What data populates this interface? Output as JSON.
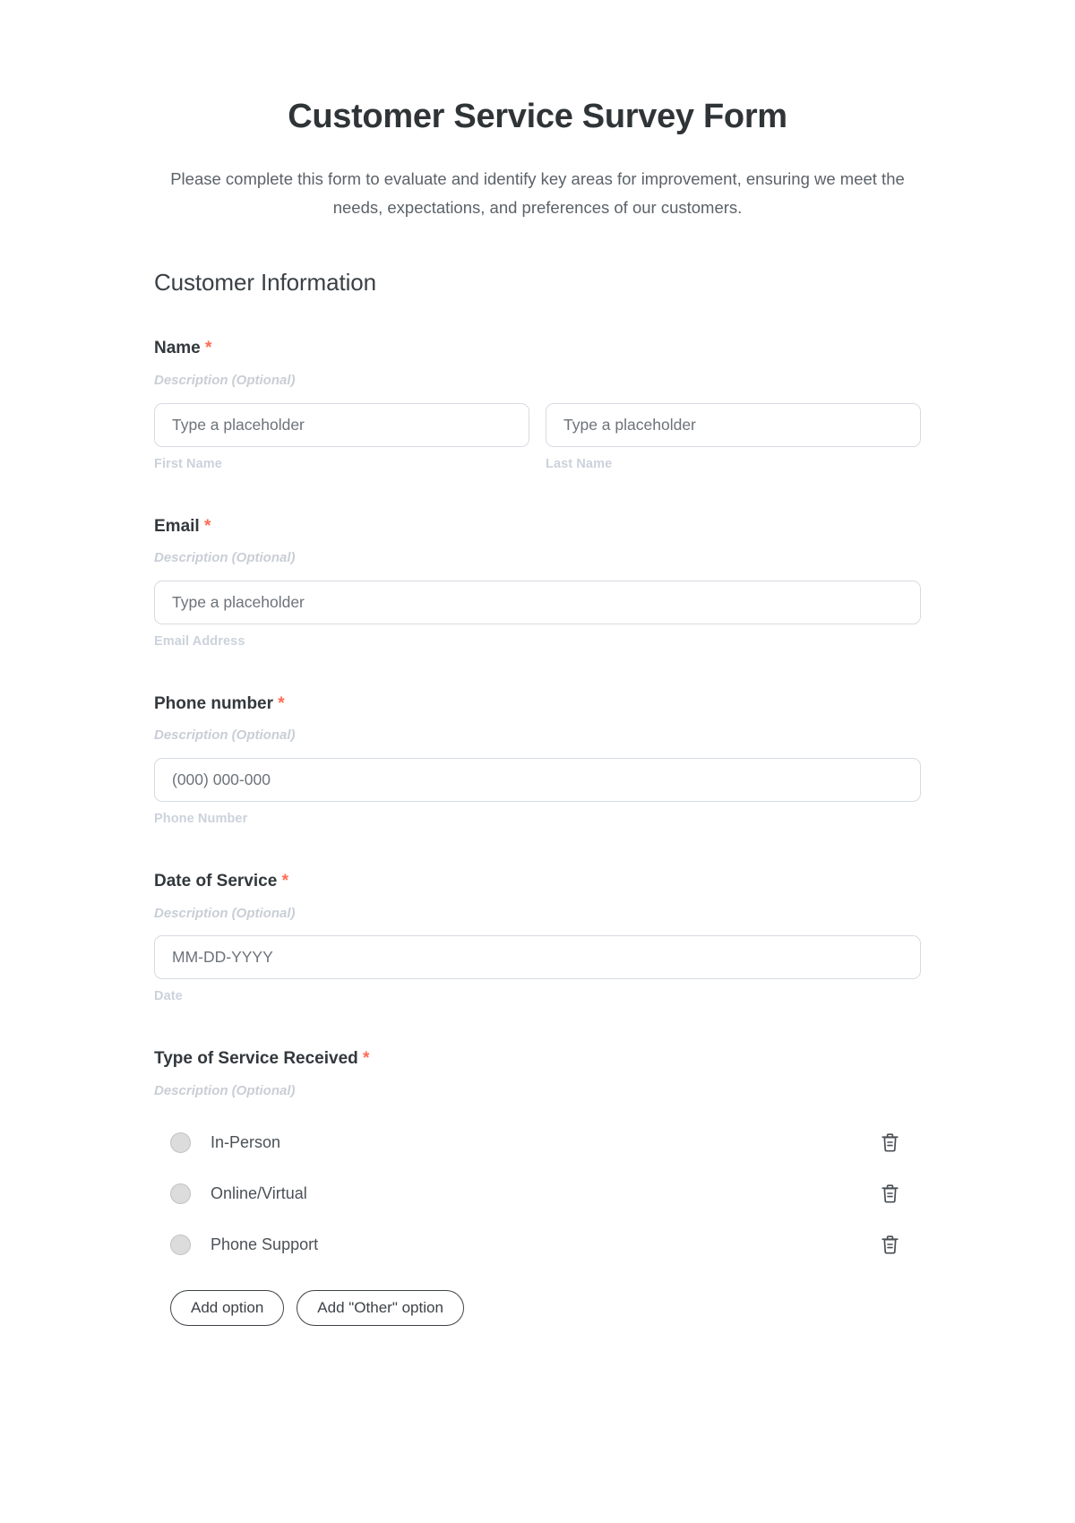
{
  "header": {
    "title": "Customer Service Survey Form",
    "subtitle": "Please complete this form to evaluate and identify key areas for improvement, ensuring we meet the needs, expectations, and preferences of our customers."
  },
  "section": {
    "title": "Customer Information"
  },
  "common": {
    "description_placeholder": "Description (Optional)",
    "required_marker": "*"
  },
  "colors": {
    "required_asterisk": "#ff6a52",
    "label_text": "#32383c",
    "description_text": "#c9ced6",
    "sub_label_text": "#ccd2dc",
    "input_border": "#d7dbe1",
    "radio_fill": "#dcdcdc",
    "pill_border": "#3d4246"
  },
  "fields": {
    "name": {
      "label": "Name",
      "required": "*",
      "description": "Description (Optional)",
      "first": {
        "placeholder": "Type a placeholder",
        "sub_label": "First Name"
      },
      "last": {
        "placeholder": "Type a placeholder",
        "sub_label": "Last Name"
      }
    },
    "email": {
      "label": "Email",
      "required": "*",
      "description": "Description (Optional)",
      "placeholder": "Type a placeholder",
      "sub_label": "Email Address"
    },
    "phone": {
      "label": "Phone number",
      "required": "*",
      "description": "Description (Optional)",
      "placeholder": "(000) 000-000",
      "sub_label": "Phone Number"
    },
    "date_of_service": {
      "label": "Date of Service ",
      "required": "*",
      "description": "Description (Optional)",
      "placeholder": "MM-DD-YYYY",
      "sub_label": "Date"
    },
    "service_type": {
      "label": "Type of Service Received",
      "required": "*",
      "description": "Description (Optional)",
      "options": [
        {
          "label": "In-Person",
          "delete_icon": "trash-icon"
        },
        {
          "label": "Online/Virtual",
          "delete_icon": "trash-icon"
        },
        {
          "label": "Phone Support",
          "delete_icon": "trash-icon"
        }
      ],
      "add_option_label": "Add option",
      "add_other_option_label": "Add \"Other\" option"
    }
  }
}
